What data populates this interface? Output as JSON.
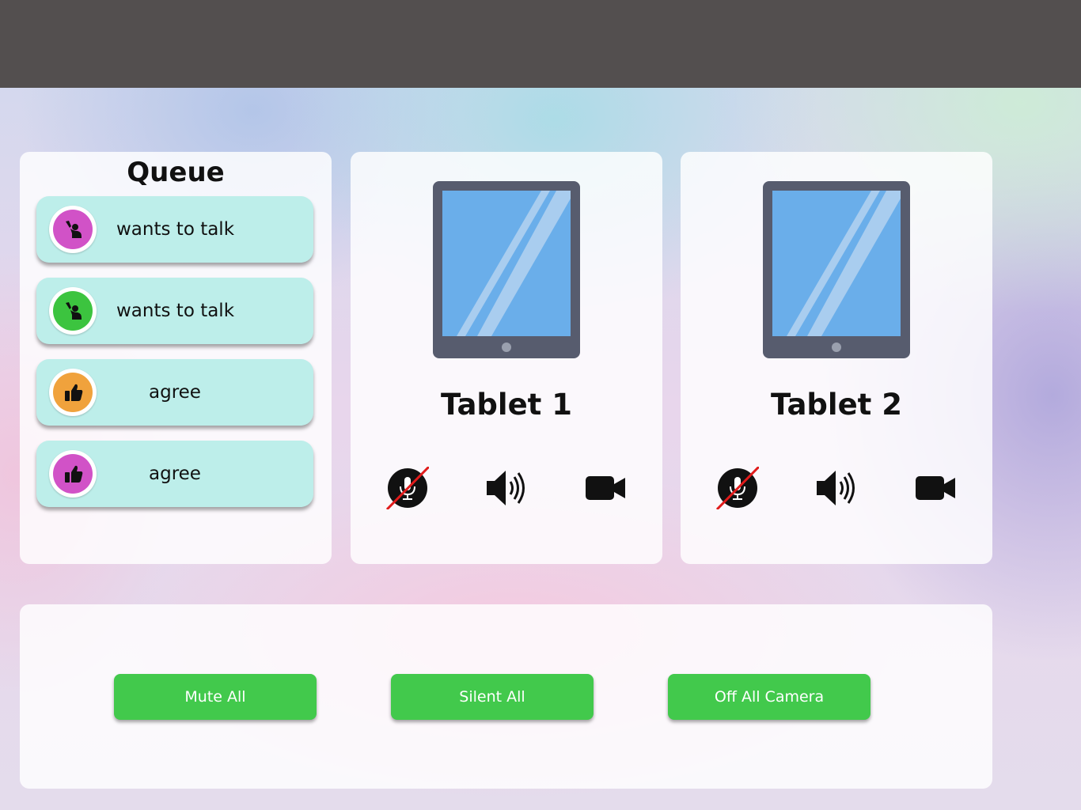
{
  "queue": {
    "title": "Queue",
    "items": [
      {
        "label": "wants to talk",
        "icon": "raise-hand-icon",
        "color": "#d152c7"
      },
      {
        "label": "wants to talk",
        "icon": "raise-hand-icon",
        "color": "#3cc43f"
      },
      {
        "label": "agree",
        "icon": "thumbs-up-icon",
        "color": "#f0a23c"
      },
      {
        "label": "agree",
        "icon": "thumbs-up-icon",
        "color": "#d152c7"
      }
    ]
  },
  "tablets": [
    {
      "name": "Tablet 1",
      "controls": [
        "microphone-muted-icon",
        "speaker-icon",
        "camera-icon"
      ]
    },
    {
      "name": "Tablet 2",
      "controls": [
        "microphone-muted-icon",
        "speaker-icon",
        "camera-icon"
      ]
    }
  ],
  "actions": {
    "mute_all": "Mute All",
    "silent_all": "Silent All",
    "off_all_camera": "Off All Camera"
  },
  "colors": {
    "topbar": "#534f4f",
    "queue_item_bg": "#bdeeea",
    "action_button": "#42c94c",
    "tablet_frame": "#575c6e",
    "tablet_screen": "#6aaeea"
  }
}
